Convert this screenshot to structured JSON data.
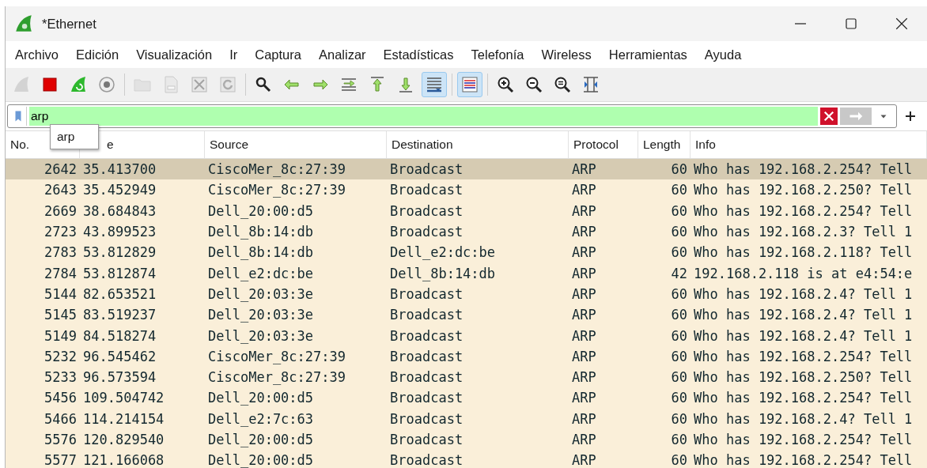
{
  "window": {
    "title": "*Ethernet"
  },
  "menu": [
    "Archivo",
    "Edición",
    "Visualización",
    "Ir",
    "Captura",
    "Analizar",
    "Estadísticas",
    "Telefonía",
    "Wireless",
    "Herramientas",
    "Ayuda"
  ],
  "toolbar": [
    [
      {
        "kind": "fin",
        "disabled": true,
        "active": false
      },
      {
        "kind": "stop",
        "disabled": false,
        "active": false
      },
      {
        "kind": "restart",
        "disabled": false,
        "active": false
      },
      {
        "kind": "options",
        "disabled": false,
        "active": false
      }
    ],
    [
      {
        "kind": "open",
        "disabled": true,
        "active": false
      },
      {
        "kind": "save",
        "disabled": true,
        "active": false
      },
      {
        "kind": "close",
        "disabled": true,
        "active": false
      },
      {
        "kind": "reload",
        "disabled": true,
        "active": false
      }
    ],
    [
      {
        "kind": "find",
        "disabled": false,
        "active": false
      },
      {
        "kind": "back",
        "disabled": false,
        "active": false
      },
      {
        "kind": "forward",
        "disabled": false,
        "active": false
      },
      {
        "kind": "goto",
        "disabled": false,
        "active": false
      },
      {
        "kind": "first",
        "disabled": false,
        "active": false
      },
      {
        "kind": "last",
        "disabled": false,
        "active": false
      },
      {
        "kind": "autoscroll",
        "disabled": false,
        "active": true
      }
    ],
    [
      {
        "kind": "colorize",
        "disabled": false,
        "active": true
      }
    ],
    [
      {
        "kind": "zoom-in",
        "disabled": false,
        "active": false
      },
      {
        "kind": "zoom-out",
        "disabled": false,
        "active": false
      },
      {
        "kind": "zoom-normal",
        "disabled": false,
        "active": false
      },
      {
        "kind": "resize",
        "disabled": false,
        "active": false
      }
    ]
  ],
  "filter": {
    "value": "arp",
    "valid": true,
    "suggestions": [
      "arp"
    ]
  },
  "packet_list": {
    "columns": [
      "No.",
      "e",
      "Source",
      "Destination",
      "Protocol",
      "Length",
      "Info"
    ],
    "rows": [
      {
        "no": "2642",
        "time": "35.413700",
        "source": "CiscoMer_8c:27:39",
        "destination": "Broadcast",
        "protocol": "ARP",
        "length": "60",
        "info": "Who has 192.168.2.254? Tell",
        "selected": true
      },
      {
        "no": "2643",
        "time": "35.452949",
        "source": "CiscoMer_8c:27:39",
        "destination": "Broadcast",
        "protocol": "ARP",
        "length": "60",
        "info": "Who has 192.168.2.250? Tell",
        "selected": false
      },
      {
        "no": "2669",
        "time": "38.684843",
        "source": "Dell_20:00:d5",
        "destination": "Broadcast",
        "protocol": "ARP",
        "length": "60",
        "info": "Who has 192.168.2.254? Tell",
        "selected": false
      },
      {
        "no": "2723",
        "time": "43.899523",
        "source": "Dell_8b:14:db",
        "destination": "Broadcast",
        "protocol": "ARP",
        "length": "60",
        "info": "Who has 192.168.2.3? Tell 1",
        "selected": false
      },
      {
        "no": "2783",
        "time": "53.812829",
        "source": "Dell_8b:14:db",
        "destination": "Dell_e2:dc:be",
        "protocol": "ARP",
        "length": "60",
        "info": "Who has 192.168.2.118? Tell",
        "selected": false
      },
      {
        "no": "2784",
        "time": "53.812874",
        "source": "Dell_e2:dc:be",
        "destination": "Dell_8b:14:db",
        "protocol": "ARP",
        "length": "42",
        "info": "192.168.2.118 is at e4:54:e",
        "selected": false
      },
      {
        "no": "5144",
        "time": "82.653521",
        "source": "Dell_20:03:3e",
        "destination": "Broadcast",
        "protocol": "ARP",
        "length": "60",
        "info": "Who has 192.168.2.4? Tell 1",
        "selected": false
      },
      {
        "no": "5145",
        "time": "83.519237",
        "source": "Dell_20:03:3e",
        "destination": "Broadcast",
        "protocol": "ARP",
        "length": "60",
        "info": "Who has 192.168.2.4? Tell 1",
        "selected": false
      },
      {
        "no": "5149",
        "time": "84.518274",
        "source": "Dell_20:03:3e",
        "destination": "Broadcast",
        "protocol": "ARP",
        "length": "60",
        "info": "Who has 192.168.2.4? Tell 1",
        "selected": false
      },
      {
        "no": "5232",
        "time": "96.545462",
        "source": "CiscoMer_8c:27:39",
        "destination": "Broadcast",
        "protocol": "ARP",
        "length": "60",
        "info": "Who has 192.168.2.254? Tell",
        "selected": false
      },
      {
        "no": "5233",
        "time": "96.573594",
        "source": "CiscoMer_8c:27:39",
        "destination": "Broadcast",
        "protocol": "ARP",
        "length": "60",
        "info": "Who has 192.168.2.250? Tell",
        "selected": false
      },
      {
        "no": "5456",
        "time": "109.504742",
        "source": "Dell_20:00:d5",
        "destination": "Broadcast",
        "protocol": "ARP",
        "length": "60",
        "info": "Who has 192.168.2.254? Tell",
        "selected": false
      },
      {
        "no": "5466",
        "time": "114.214154",
        "source": "Dell_e2:7c:63",
        "destination": "Broadcast",
        "protocol": "ARP",
        "length": "60",
        "info": "Who has 192.168.2.4? Tell 1",
        "selected": false
      },
      {
        "no": "5576",
        "time": "120.829540",
        "source": "Dell_20:00:d5",
        "destination": "Broadcast",
        "protocol": "ARP",
        "length": "60",
        "info": "Who has 192.168.2.254? Tell",
        "selected": false
      },
      {
        "no": "5577",
        "time": "121.166068",
        "source": "Dell_20:00:d5",
        "destination": "Broadcast",
        "protocol": "ARP",
        "length": "60",
        "info": "Who has 192.168.2.254? Tell",
        "selected": false
      }
    ]
  }
}
